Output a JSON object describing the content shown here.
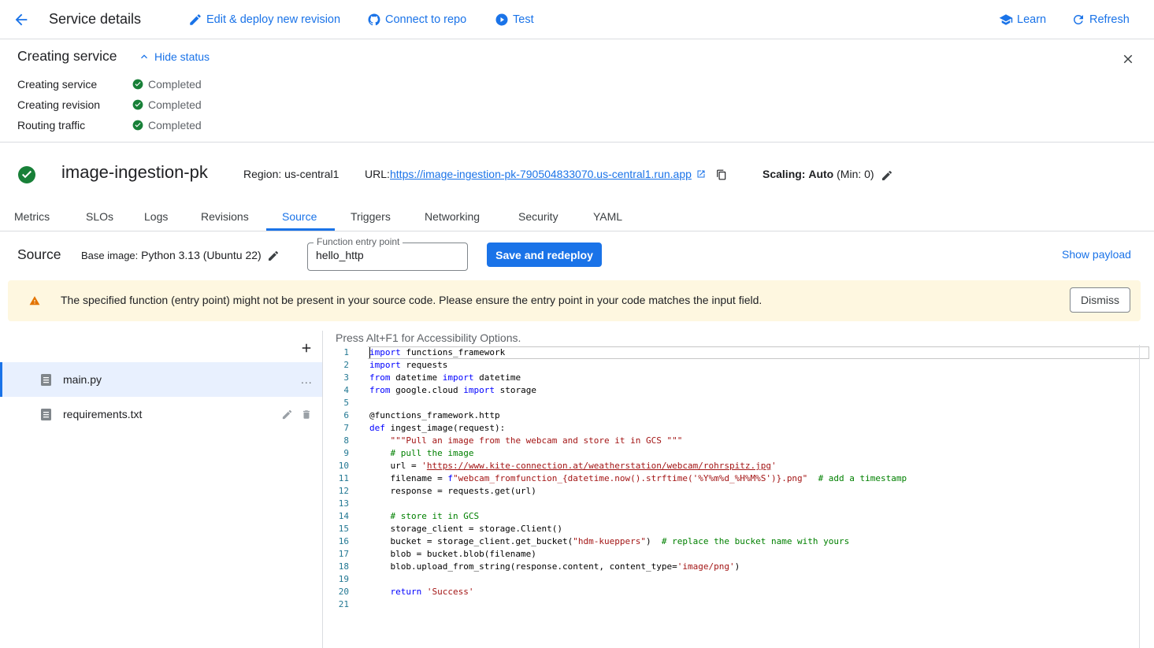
{
  "header": {
    "title": "Service details",
    "actions": {
      "edit": "Edit & deploy new revision",
      "connect": "Connect to repo",
      "test": "Test",
      "learn": "Learn",
      "refresh": "Refresh"
    }
  },
  "status": {
    "title": "Creating service",
    "toggle": "Hide status",
    "rows": [
      {
        "label": "Creating service",
        "value": "Completed"
      },
      {
        "label": "Creating revision",
        "value": "Completed"
      },
      {
        "label": "Routing traffic",
        "value": "Completed"
      }
    ]
  },
  "service": {
    "name": "image-ingestion-pk",
    "region": "Region: us-central1",
    "url_label": "URL:",
    "url": "https://image-ingestion-pk-790504833070.us-central1.run.app",
    "scaling_label": "Scaling:",
    "scaling_value": "Auto",
    "scaling_min": "(Min: 0)"
  },
  "tabs": [
    "Metrics",
    "SLOs",
    "Logs",
    "Revisions",
    "Source",
    "Triggers",
    "Networking",
    "Security",
    "YAML"
  ],
  "source": {
    "title": "Source",
    "base_label": "Base image:",
    "base_value": "Python 3.13 (Ubuntu 22)",
    "entry_label": "Function entry point",
    "entry_value": "hello_http",
    "save": "Save and redeploy",
    "show_payload": "Show payload"
  },
  "warning": {
    "text": "The specified function (entry point) might not be present in your source code. Please ensure the entry point in your code matches the input field.",
    "dismiss": "Dismiss"
  },
  "files": [
    {
      "name": "main.py",
      "more": "..."
    },
    {
      "name": "requirements.txt"
    }
  ],
  "editor": {
    "hint": "Press Alt+F1 for Accessibility Options.",
    "lines": [
      "import functions_framework",
      "import requests",
      "from datetime import datetime",
      "from google.cloud import storage",
      "",
      "@functions_framework.http",
      "def ingest_image(request):",
      "    \"\"\"Pull an image from the webcam and store it in GCS \"\"\"",
      "    # pull the image",
      "    url = 'https://www.kite-connection.at/weatherstation/webcam/rohrspitz.jpg'",
      "    filename = f\"webcam_fromfunction_{datetime.now().strftime('%Y%m%d_%H%M%S')}.png\"  # add a timestamp",
      "    response = requests.get(url)",
      "",
      "    # store it in GCS",
      "    storage_client = storage.Client()",
      "    bucket = storage_client.get_bucket(\"hdm-kueppers\")  # replace the bucket name with yours",
      "    blob = bucket.blob(filename)",
      "    blob.upload_from_string(response.content, content_type='image/png')",
      "",
      "    return 'Success'",
      ""
    ]
  },
  "colors": {
    "accent": "#1a73e8",
    "success": "#188038",
    "warning_bg": "#fef7e0",
    "warning_icon": "#e37400"
  }
}
